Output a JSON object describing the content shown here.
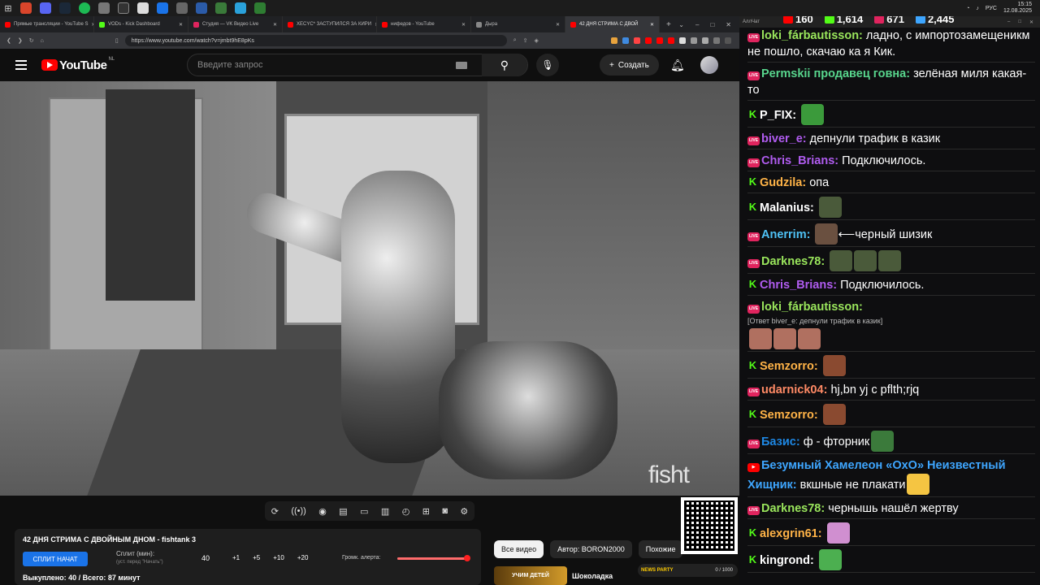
{
  "taskbar": {
    "tray_lang": "РУС",
    "time": "15:15",
    "date": "12.08.2025"
  },
  "browser": {
    "tabs": [
      {
        "label": "Прямые трансляции - YouTube S",
        "color": "#ff0000"
      },
      {
        "label": "VODs - Kick Dashboard",
        "color": "#53fc18"
      },
      {
        "label": "Студия — VK Видео Live",
        "color": "#e0245e"
      },
      {
        "label": "XECYC* ЗАСТУПИЛСЯ ЗА КИРИ",
        "color": "#ff0000"
      },
      {
        "label": "нифедов - YouTube",
        "color": "#ff0000"
      },
      {
        "label": "Дыра",
        "color": "#888888"
      },
      {
        "label": "42 ДНЯ СТРИМА С ДВОЙ",
        "color": "#ff0000"
      }
    ],
    "new_tab": "+",
    "url": "https://www.youtube.com/watch?v=jmbt9hE8pKs"
  },
  "yt_header": {
    "logo": "YouTube",
    "region": "NL",
    "search_placeholder": "Введите запрос",
    "create_label": "Создать"
  },
  "video": {
    "watermark": "fisht"
  },
  "stream_panel": {
    "title": "42 ДНЯ СТРИМА С ДВОЙНЫМ ДНОМ - fishtank 3",
    "split_button": "СПЛИТ НАЧАТ",
    "split_label": "Сплит (мин):",
    "split_sub": "(уст. перед \"Начать\")",
    "split_value": "40",
    "increments": [
      "+1",
      "+5",
      "+10",
      "+20"
    ],
    "volume_label": "Громк. алерта:",
    "volume_level": 1.0,
    "stats": "Выкуплено: 40 / Всего: 87 минут"
  },
  "filter_chips": [
    "Все видео",
    "Автор: BORON2000",
    "Похожие"
  ],
  "reco": {
    "thumb_text": "УЧИМ ДЕТЕЙ",
    "title": "Шоколадка"
  },
  "overlay": {
    "party": "NEWS PARTY",
    "count": "0 / 1000"
  },
  "chat": {
    "window_title": "АллЧат",
    "stats": [
      {
        "icon": "youtube-icon",
        "value": "160",
        "color": "#ff0000"
      },
      {
        "icon": "kick-icon",
        "value": "1,614",
        "color": "#53fc18"
      },
      {
        "icon": "vk-icon",
        "value": "671",
        "color": "#e0245e"
      },
      {
        "icon": "viewers-icon",
        "value": "2,445",
        "color": "#3ea6ff"
      }
    ],
    "messages": [
      {
        "platform": "vk",
        "user": "loki_fárbautisson:",
        "color": "#9ae65c",
        "text": "ладно, с импортозамещеникм не пошло, скачаю ка я Кик."
      },
      {
        "platform": "vk",
        "user": "Permskii продавец говна:",
        "color": "#58d68d",
        "text": "зелёная миля какая-то"
      },
      {
        "platform": "kick",
        "user": "P_FIX:",
        "color": "#ffffff",
        "text": "",
        "emotes": [
          "#3b9a3b"
        ]
      },
      {
        "platform": "vk",
        "user": "biver_e:",
        "color": "#b05cf0",
        "text": "депнули трафик в казик"
      },
      {
        "platform": "vk",
        "user": "Chris_Brians:",
        "color": "#b05cf0",
        "text": "Подключилось."
      },
      {
        "platform": "kick",
        "user": "Gudzila:",
        "color": "#ffb347",
        "text": "опа"
      },
      {
        "platform": "kick",
        "user": "Malanius:",
        "color": "#ffffff",
        "text": "",
        "emotes": [
          "#4a5a3a"
        ]
      },
      {
        "platform": "vk",
        "user": "Anerrim:",
        "color": "#4fc3f7",
        "text": "⟵черный шизик",
        "emotes": [
          "#6a5040"
        ]
      },
      {
        "platform": "vk",
        "user": "Darknes78:",
        "color": "#9ae65c",
        "text": "",
        "emotes": [
          "#4a5a3a",
          "#4a5a3a",
          "#4a5a3a"
        ]
      },
      {
        "platform": "kick",
        "user": "Chris_Brians:",
        "color": "#b05cf0",
        "text": "Подключилось."
      },
      {
        "platform": "vk",
        "user": "loki_fárbautisson:",
        "color": "#9ae65c",
        "text": "",
        "reply": "[Ответ biver_e: депнули трафик в казик]",
        "emotes": [
          "#b07060",
          "#b07060",
          "#b07060"
        ],
        "emotes_newline": true
      },
      {
        "platform": "kick",
        "user": "Semzorro:",
        "color": "#ffb347",
        "text": "",
        "emotes": [
          "#8a4a30"
        ]
      },
      {
        "platform": "vk",
        "user": "udarnick04:",
        "color": "#ff8a65",
        "text": "hj,bn yj c pflth;rjq"
      },
      {
        "platform": "kick",
        "user": "Semzorro:",
        "color": "#ffb347",
        "text": "",
        "emotes": [
          "#8a4a30"
        ]
      },
      {
        "platform": "vk",
        "user": "Базис:",
        "color": "#1e88e5",
        "text": "ф - фторник",
        "emotes": [
          "#3b7a3b"
        ]
      },
      {
        "platform": "yt",
        "user": "Безумный Хамелеон «OxO» Неизвестный Хищник:",
        "color": "#3ea6ff",
        "text": "вкшные не плакати",
        "emotes": [
          "#f5c542"
        ]
      },
      {
        "platform": "vk",
        "user": "Darknes78:",
        "color": "#9ae65c",
        "text": "чернышь нашёл жертву"
      },
      {
        "platform": "kick",
        "user": "alexgrin61:",
        "color": "#ffb347",
        "text": "",
        "emotes": [
          "#d08fd0"
        ]
      },
      {
        "platform": "kick",
        "user": "kingrond:",
        "color": "#ffffff",
        "text": "",
        "emotes": [
          "#4caf50"
        ]
      }
    ]
  }
}
